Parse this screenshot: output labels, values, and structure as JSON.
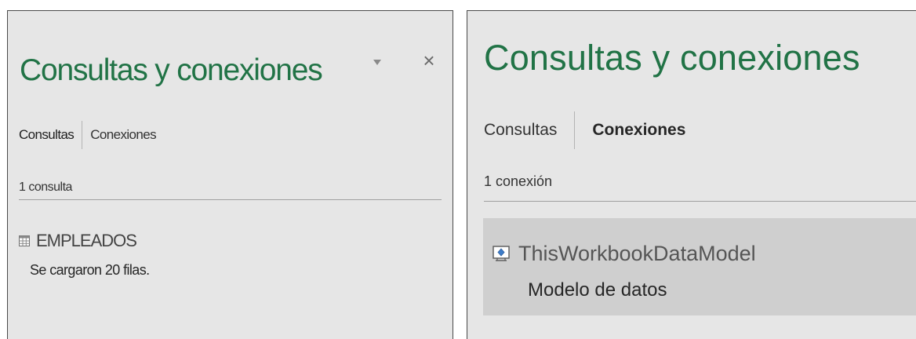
{
  "left_pane": {
    "title": "Consultas y conexiones",
    "tabs": [
      {
        "label": "Consultas",
        "active": true
      },
      {
        "label": "Conexiones",
        "active": false
      }
    ],
    "count_label": "1 consulta",
    "queries": [
      {
        "name": "EMPLEADOS",
        "status": "Se cargaron 20 filas.",
        "icon": "table-icon"
      }
    ],
    "controls": {
      "dropdown_icon": "dropdown-arrow-icon",
      "close_label": "×"
    }
  },
  "right_pane": {
    "title": "Consultas y conexiones",
    "tabs": [
      {
        "label": "Consultas",
        "active": false
      },
      {
        "label": "Conexiones",
        "active": true
      }
    ],
    "count_label": "1 conexión",
    "connections": [
      {
        "name": "ThisWorkbookDataModel",
        "description": "Modelo de datos",
        "icon": "data-model-icon",
        "selected": true
      }
    ]
  },
  "colors": {
    "title_green": "#217346",
    "pane_background": "#e6e6e6",
    "selected_item_background": "#cfcfcf"
  }
}
